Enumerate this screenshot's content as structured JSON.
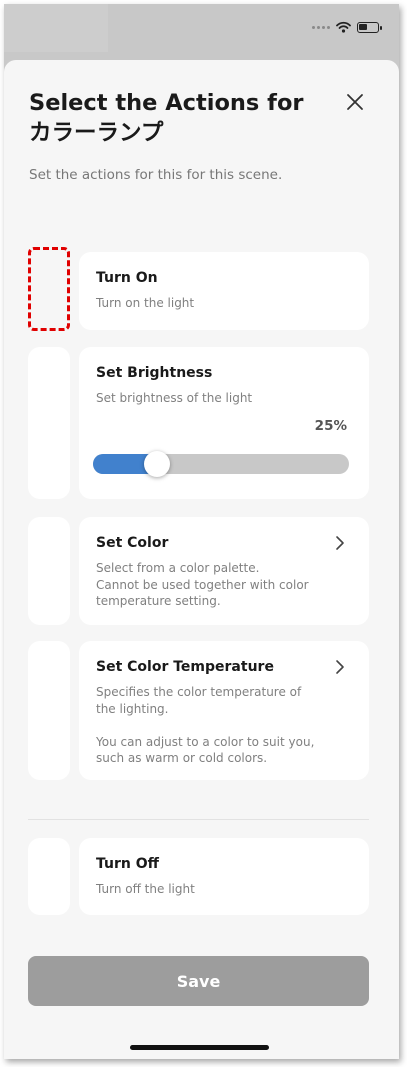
{
  "colors": {
    "accent": "#4181cd",
    "save_button_bg": "#9d9d9d",
    "highlight_border": "#e00000"
  },
  "header": {
    "title": "Select the Actions for カラーランプ",
    "close_icon": "close-icon",
    "subtitle": "Set the actions for this for this scene."
  },
  "actions": [
    {
      "title": "Turn On",
      "description": "Turn on the light"
    },
    {
      "title": "Set Brightness",
      "description": "Set brightness of the light",
      "value_label": "25%",
      "level": 0.25
    },
    {
      "title": "Set Color",
      "description": "Select from a color palette.\n Cannot be used together with color temperature setting.",
      "icon": "chevron-right-icon"
    },
    {
      "title": "Set Color Temperature",
      "description": "Specifies the color temperature of the lighting.\n\nYou can adjust to a color to suit you, such as warm or cold colors.",
      "icon": "chevron-right-icon"
    },
    {
      "title": "Turn Off",
      "description": "Turn off the light"
    }
  ],
  "footer": {
    "save_label": "Save"
  },
  "status_bar": {
    "icons": [
      "signal-dots-icon",
      "wifi-icon",
      "battery-icon"
    ]
  }
}
